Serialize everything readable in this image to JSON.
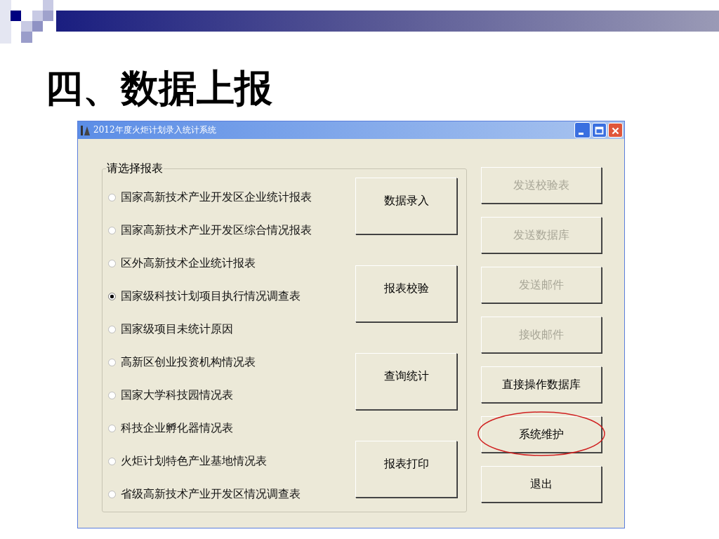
{
  "slide": {
    "title": "四、数据上报"
  },
  "window": {
    "title": "2012年度火炬计划录入统计系统"
  },
  "group": {
    "label": "请选择报表"
  },
  "report_options": [
    {
      "label": "国家高新技术产业开发区企业统计报表",
      "selected": false
    },
    {
      "label": "国家高新技术产业开发区综合情况报表",
      "selected": false
    },
    {
      "label": "区外高新技术企业统计报表",
      "selected": false
    },
    {
      "label": "国家级科技计划项目执行情况调查表",
      "selected": true
    },
    {
      "label": "国家级项目未统计原因",
      "selected": false
    },
    {
      "label": "高新区创业投资机构情况表",
      "selected": false
    },
    {
      "label": "国家大学科技园情况表",
      "selected": false
    },
    {
      "label": "科技企业孵化器情况表",
      "selected": false
    },
    {
      "label": "火炬计划特色产业基地情况表",
      "selected": false
    },
    {
      "label": "省级高新技术产业开发区情况调查表",
      "selected": false
    }
  ],
  "action_buttons": [
    "数据录入",
    "报表校验",
    "查询统计",
    "报表打印"
  ],
  "side_buttons": [
    {
      "label": "发送校验表",
      "disabled": true,
      "circled": false
    },
    {
      "label": "发送数据库",
      "disabled": true,
      "circled": false
    },
    {
      "label": "发送邮件",
      "disabled": true,
      "circled": false
    },
    {
      "label": "接收邮件",
      "disabled": true,
      "circled": false
    },
    {
      "label": "直接操作数据库",
      "disabled": false,
      "circled": false
    },
    {
      "label": "系统维护",
      "disabled": false,
      "circled": true
    },
    {
      "label": "退出",
      "disabled": false,
      "circled": false
    }
  ]
}
